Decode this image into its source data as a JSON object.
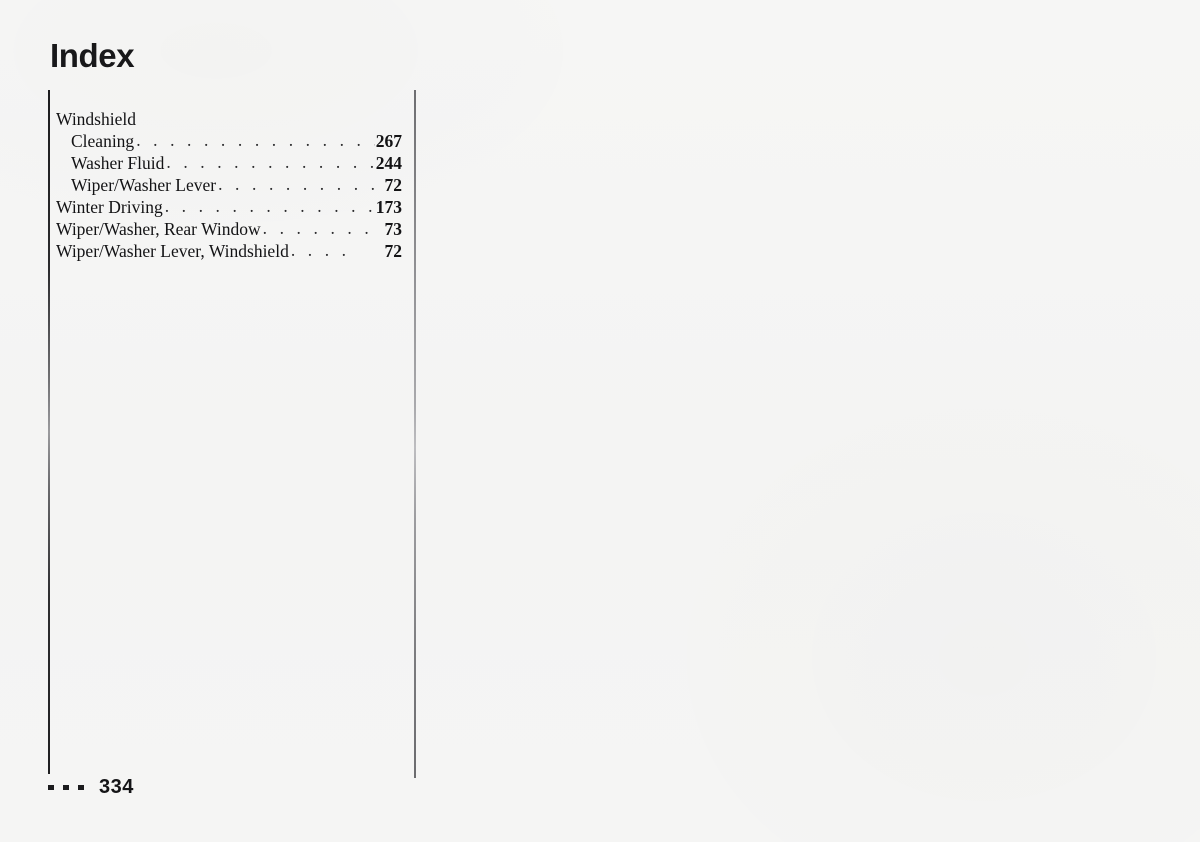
{
  "page": {
    "title": "Index",
    "background_color": "#f5f5f4",
    "text_color": "#131315"
  },
  "index": {
    "entries": [
      {
        "label": "Windshield",
        "level": 1,
        "leader": "",
        "page": ""
      },
      {
        "label": "Cleaning",
        "level": 2,
        "leader": ". . . . . . . . . . . . . . . . . .",
        "page": "267"
      },
      {
        "label": "Washer Fluid",
        "level": 2,
        "leader": ". . . . . . . . . . . . . . . .",
        "page": "244"
      },
      {
        "label": "Wiper/Washer Lever",
        "level": 2,
        "leader": ". . . . . . . . . . .",
        "page": "72"
      },
      {
        "label": "Winter Driving",
        "level": 1,
        "leader": ". . . . . . . . . . . . . . . . .",
        "page": "173"
      },
      {
        "label": "Wiper/Washer, Rear Window",
        "level": 1,
        "leader": ". . . . . . .",
        "page": "73"
      },
      {
        "label": "Wiper/Washer Lever, Windshield",
        "level": 1,
        "leader": ". . . .",
        "page": "72"
      }
    ]
  },
  "footer": {
    "dots": [
      "dot",
      "dot",
      "dot"
    ],
    "page_number": "334"
  }
}
